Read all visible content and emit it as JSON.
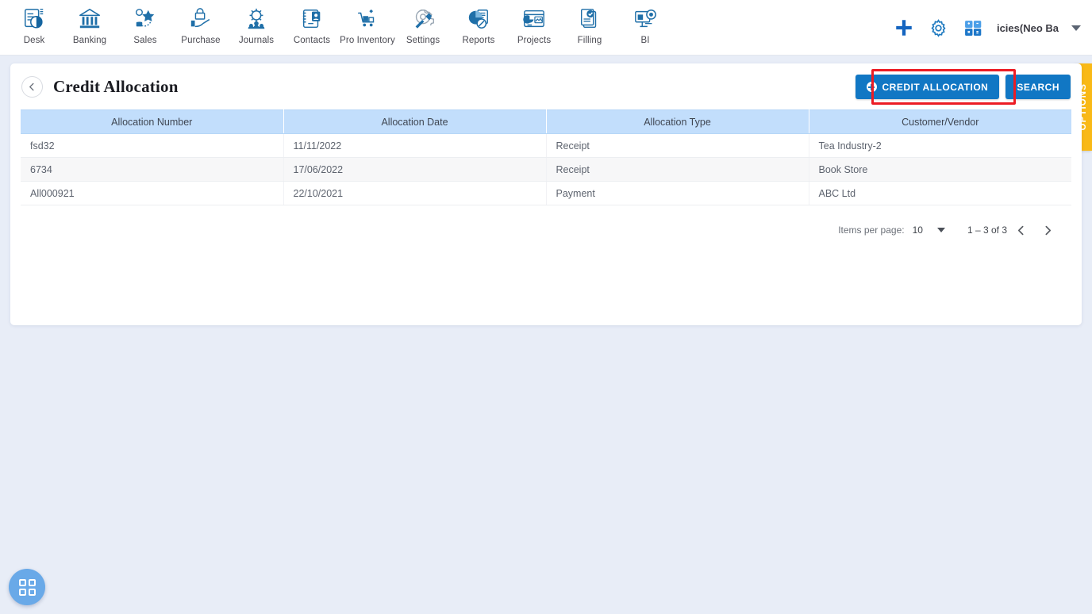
{
  "topnav": {
    "modules": [
      {
        "label": "Desk",
        "icon": "desk-icon"
      },
      {
        "label": "Banking",
        "icon": "bank-icon"
      },
      {
        "label": "Sales",
        "icon": "sales-icon"
      },
      {
        "label": "Purchase",
        "icon": "purchase-icon"
      },
      {
        "label": "Journals",
        "icon": "journals-icon"
      },
      {
        "label": "Contacts",
        "icon": "contacts-icon"
      },
      {
        "label": "Pro Inventory",
        "icon": "inventory-icon"
      },
      {
        "label": "Settings",
        "icon": "settings-icon"
      },
      {
        "label": "Reports",
        "icon": "reports-icon"
      },
      {
        "label": "Projects",
        "icon": "projects-icon"
      },
      {
        "label": "Filling",
        "icon": "filling-icon"
      },
      {
        "label": "BI",
        "icon": "bi-icon"
      }
    ],
    "add_icon": "plus-icon",
    "settings_icon": "gear-icon",
    "calculator_icon": "calculator-icon",
    "company": "icies(Neo Ba",
    "company_caret": "chevron-down-icon"
  },
  "header": {
    "back_icon": "chevron-left-icon",
    "title": "Credit Allocation",
    "primary_button": "CREDIT ALLOCATION",
    "primary_button_icon": "plus-circle-icon",
    "search_button": "SEARCH"
  },
  "options_tab": {
    "label": "OPTIONS"
  },
  "table": {
    "columns": [
      "Allocation Number",
      "Allocation Date",
      "Allocation Type",
      "Customer/Vendor"
    ],
    "rows": [
      {
        "number": "fsd32",
        "date": "11/11/2022",
        "type": "Receipt",
        "party": "Tea Industry-2"
      },
      {
        "number": "6734",
        "date": "17/06/2022",
        "type": "Receipt",
        "party": "Book Store"
      },
      {
        "number": "All000921",
        "date": "22/10/2021",
        "type": "Payment",
        "party": "ABC Ltd"
      }
    ]
  },
  "paginator": {
    "items_per_page_label": "Items per page:",
    "items_per_page_value": "10",
    "range_label": "1 – 3 of 3",
    "prev_icon": "chevron-left-icon",
    "next_icon": "chevron-right-icon"
  },
  "fab": {
    "icon": "grid-apps-icon"
  },
  "colors": {
    "accent_blue": "#1177c4",
    "table_header_blue": "#c2defc",
    "highlight_red": "#ec1c24",
    "options_yellow": "#f9b917",
    "page_background": "#e8edf7",
    "fab_blue": "#69a9e8"
  }
}
